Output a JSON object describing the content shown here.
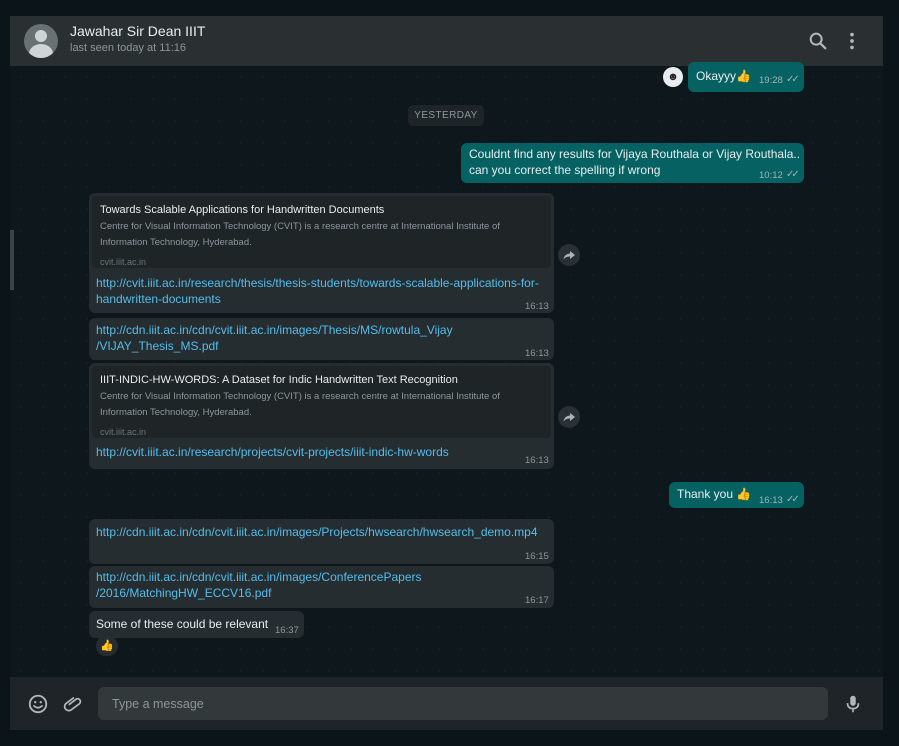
{
  "contact": {
    "name": "Jawahar Sir Dean IIIT",
    "status": "last seen today at 11:16"
  },
  "icons": {
    "search": "search-icon",
    "menu": "kebab-menu-icon",
    "emoji": "emoji-icon",
    "attach": "paperclip-icon",
    "mic": "microphone-icon",
    "forward": "forward-icon",
    "ticks": "double-check-icon"
  },
  "colors": {
    "outgoing": "#056162",
    "incoming": "#262d31",
    "link": "#53bdeb",
    "header": "#2a2f32"
  },
  "messages": {
    "m1": {
      "text": "Okayyy👍",
      "time": "19:28",
      "ticks": "✓✓",
      "reaction": "☻"
    },
    "separator": "YESTERDAY",
    "m2": {
      "line1": "Couldnt find any results for Vijaya Routhala or Vijay Routhala..",
      "line2": "can you correct the spelling if wrong",
      "time": "10:12",
      "ticks": "✓✓"
    },
    "m3": {
      "preview_title": "Towards Scalable Applications for Handwritten Documents",
      "preview_desc1": "Centre for Visual Information Technology (CVIT) is a research centre at International Institute of",
      "preview_desc2": "Information Technology, Hyderabad.",
      "preview_site": "cvit.iiit.ac.in",
      "link1": "http://cvit.iiit.ac.in/research/thesis/thesis-students/towards-scalable-applications-for-",
      "link2": "handwritten-documents",
      "time": "16:13"
    },
    "m4": {
      "link1": "http://cdn.iiit.ac.in/cdn/cvit.iiit.ac.in/images/Thesis/MS/rowtula_Vijay",
      "link2": "/VIJAY_Thesis_MS.pdf",
      "time": "16:13"
    },
    "m5": {
      "preview_title": "IIIT-INDIC-HW-WORDS: A Dataset for Indic Handwritten Text Recognition",
      "preview_desc1": "Centre for Visual Information Technology (CVIT) is a research centre at International Institute of",
      "preview_desc2": "Information Technology, Hyderabad.",
      "preview_site": "cvit.iiit.ac.in",
      "link": "http://cvit.iiit.ac.in/research/projects/cvit-projects/iiit-indic-hw-words",
      "time": "16:13"
    },
    "m6": {
      "text": "Thank you 👍",
      "time": "16:13",
      "ticks": "✓✓"
    },
    "m7": {
      "link": "http://cdn.iiit.ac.in/cdn/cvit.iiit.ac.in/images/Projects/hwsearch/hwsearch_demo.mp4",
      "time": "16:15"
    },
    "m8": {
      "link1": "http://cdn.iiit.ac.in/cdn/cvit.iiit.ac.in/images/ConferencePapers",
      "link2": "/2016/MatchingHW_ECCV16.pdf",
      "time": "16:17"
    },
    "m9": {
      "text": "Some of these could be relevant",
      "time": "16:37",
      "reaction": "👍"
    }
  },
  "composer": {
    "placeholder": "Type a message"
  }
}
